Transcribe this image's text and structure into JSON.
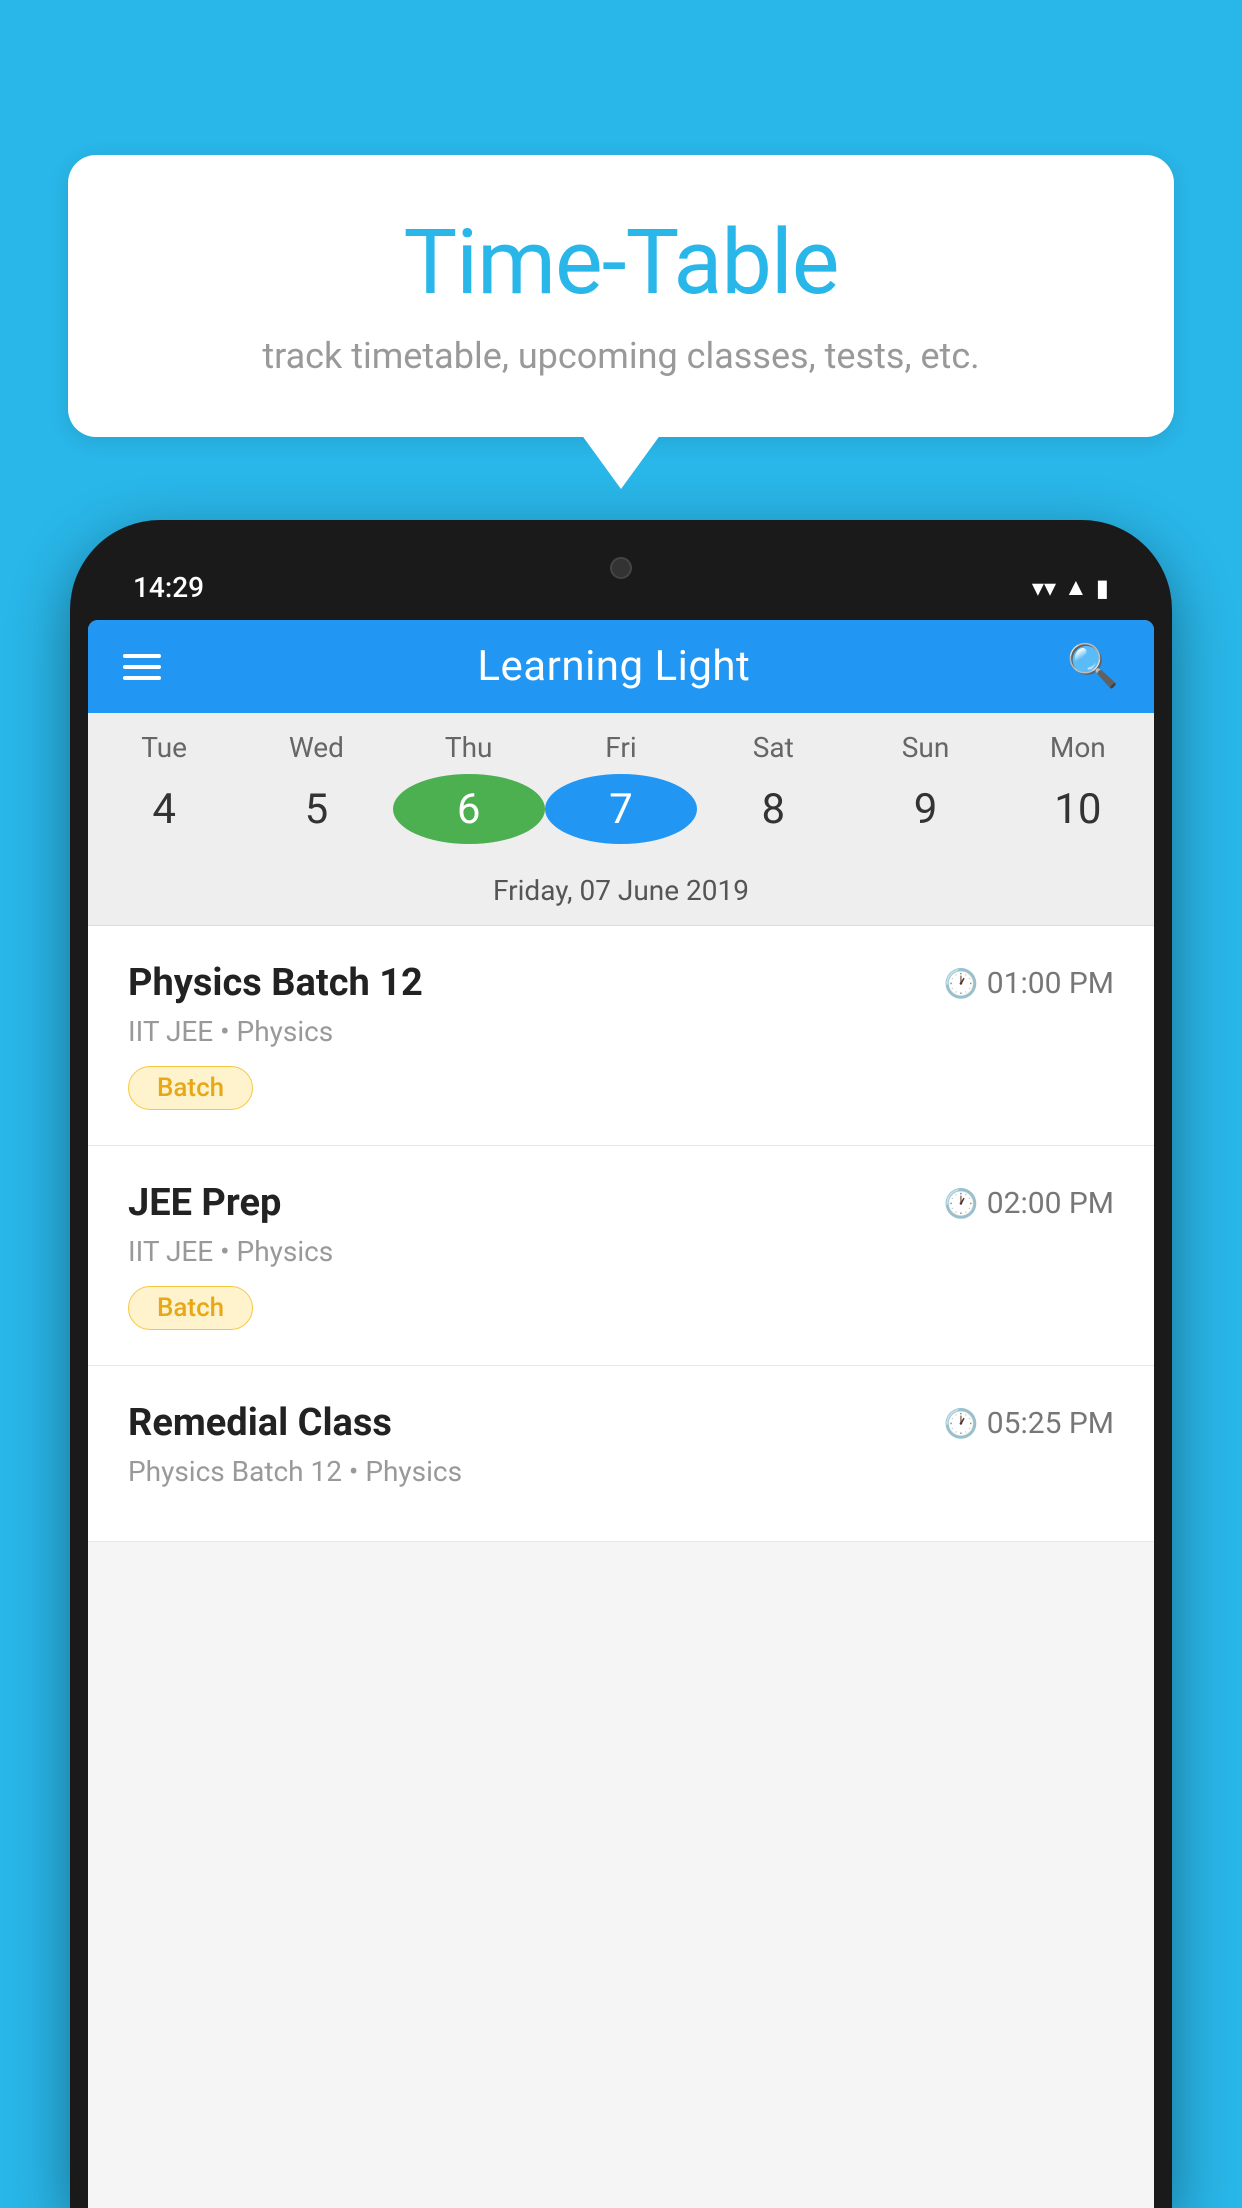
{
  "background_color": "#29B6E8",
  "speech_bubble": {
    "title": "Time-Table",
    "subtitle": "track timetable, upcoming classes, tests, etc."
  },
  "phone": {
    "status_bar": {
      "time": "14:29",
      "wifi": "▼",
      "signal": "▲",
      "battery": "▮"
    },
    "app_header": {
      "title": "Learning Light",
      "search_label": "search"
    },
    "calendar": {
      "days": [
        {
          "label": "Tue",
          "number": "4"
        },
        {
          "label": "Wed",
          "number": "5"
        },
        {
          "label": "Thu",
          "number": "6",
          "state": "today"
        },
        {
          "label": "Fri",
          "number": "7",
          "state": "selected"
        },
        {
          "label": "Sat",
          "number": "8"
        },
        {
          "label": "Sun",
          "number": "9"
        },
        {
          "label": "Mon",
          "number": "10"
        }
      ],
      "selected_date": "Friday, 07 June 2019"
    },
    "schedule": [
      {
        "title": "Physics Batch 12",
        "time": "01:00 PM",
        "meta": "IIT JEE • Physics",
        "tag": "Batch"
      },
      {
        "title": "JEE Prep",
        "time": "02:00 PM",
        "meta": "IIT JEE • Physics",
        "tag": "Batch"
      },
      {
        "title": "Remedial Class",
        "time": "05:25 PM",
        "meta": "Physics Batch 12 • Physics",
        "tag": ""
      }
    ]
  }
}
